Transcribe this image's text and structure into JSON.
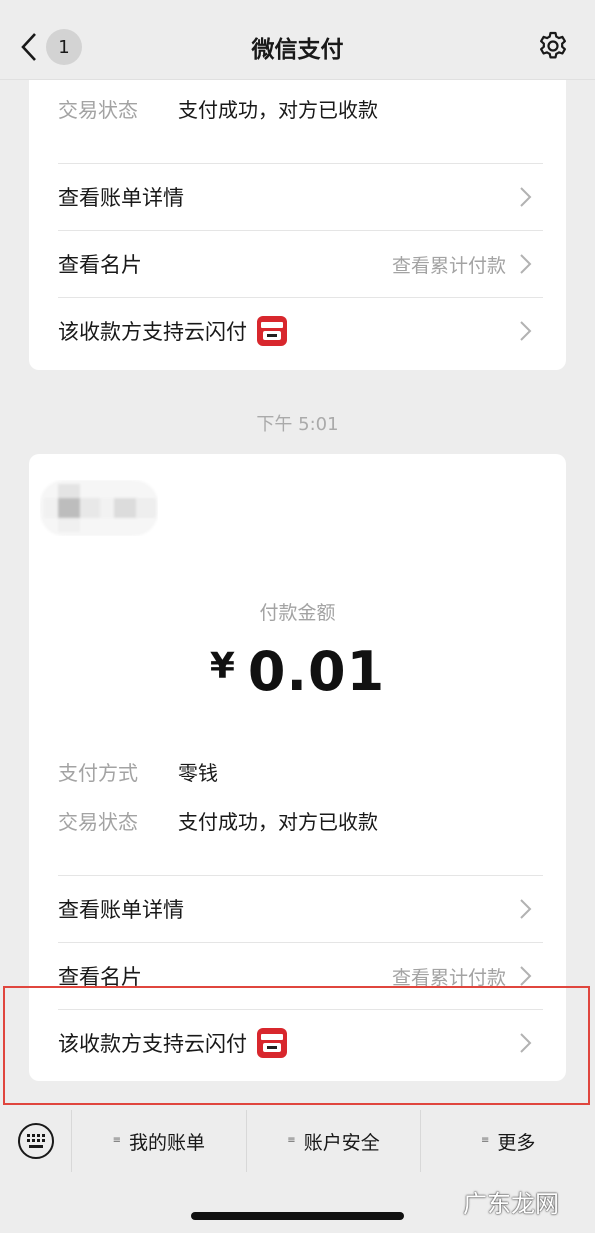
{
  "navbar": {
    "badge_count": "1",
    "title": "微信支付"
  },
  "top_card": {
    "status_label": "交易状态",
    "status_value": "支付成功，对方已收款",
    "links": {
      "bill_detail": "查看账单详情",
      "card_view": "查看名片",
      "card_aside": "查看累计付款",
      "unionpay": "该收款方支持云闪付"
    }
  },
  "timestamp": "下午 5:01",
  "main_card": {
    "amount_label": "付款金额",
    "currency": "¥",
    "amount": "0.01",
    "method_label": "支付方式",
    "method_value": "零钱",
    "status_label": "交易状态",
    "status_value": "支付成功，对方已收款",
    "links": {
      "bill_detail": "查看账单详情",
      "card_view": "查看名片",
      "card_aside": "查看累计付款",
      "unionpay": "该收款方支持云闪付"
    }
  },
  "tabbar": {
    "my_bills": "我的账单",
    "account_security": "账户安全",
    "more": "更多"
  },
  "icons": {
    "back": "chevron-left-icon",
    "settings": "gear-icon",
    "keyboard": "keyboard-icon",
    "unionpay": "unionpay-icon",
    "chevron": "chevron-right-icon"
  },
  "colors": {
    "background": "#ededed",
    "card": "#ffffff",
    "highlight": "#e0463e",
    "unionpay_red": "#d8272d"
  },
  "watermark": "广东龙网"
}
